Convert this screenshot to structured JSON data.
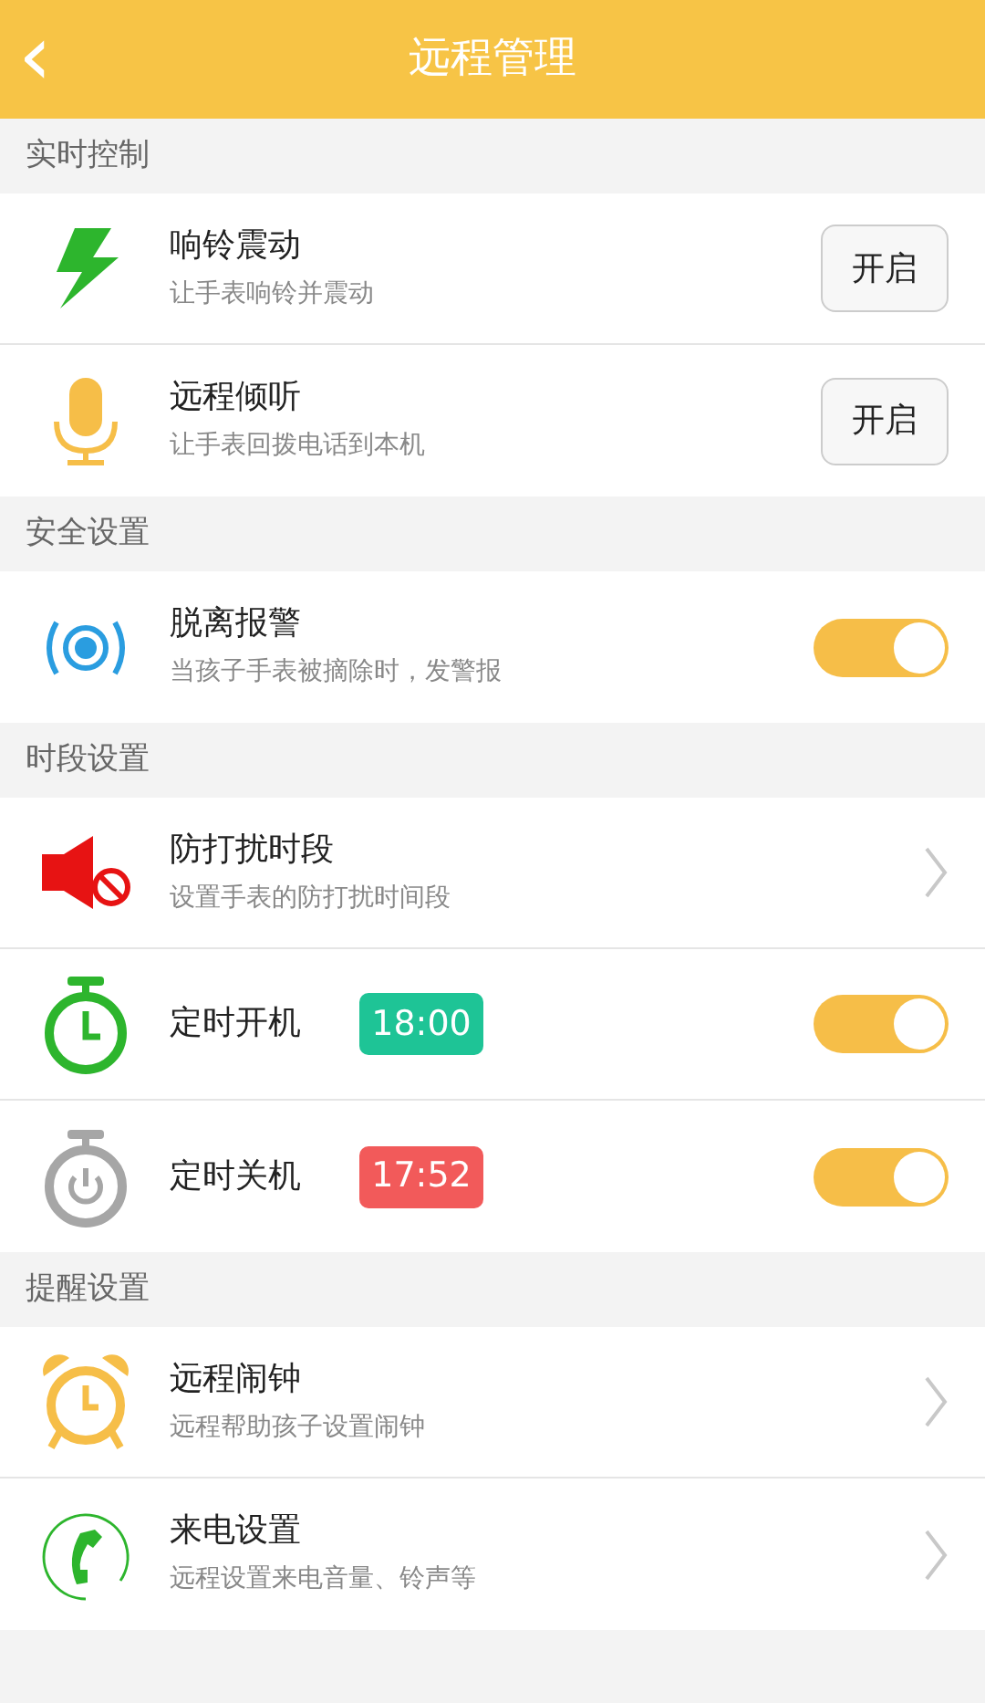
{
  "header": {
    "back": "‹",
    "title": "远程管理"
  },
  "sections": [
    {
      "title": "实时控制",
      "items": [
        {
          "kind": "button",
          "title": "响铃震动",
          "subtitle": "让手表响铃并震动",
          "button": "开启"
        },
        {
          "kind": "button",
          "title": "远程倾听",
          "subtitle": "让手表回拨电话到本机",
          "button": "开启"
        }
      ]
    },
    {
      "title": "安全设置",
      "items": [
        {
          "kind": "toggle",
          "title": "脱离报警",
          "subtitle": "当孩子手表被摘除时，发警报",
          "on": true
        }
      ]
    },
    {
      "title": "时段设置",
      "items": [
        {
          "kind": "chevron",
          "title": "防打扰时段",
          "subtitle": "设置手表的防打扰时间段"
        },
        {
          "kind": "toggle",
          "title": "定时开机",
          "time": {
            "text": "18:00",
            "color": "#1ec496"
          },
          "on": true
        },
        {
          "kind": "toggle",
          "title": "定时关机",
          "time": {
            "text": "17:52",
            "color": "#f25a5a"
          },
          "on": true
        }
      ]
    },
    {
      "title": "提醒设置",
      "items": [
        {
          "kind": "chevron",
          "title": "远程闹钟",
          "subtitle": "远程帮助孩子设置闹钟"
        },
        {
          "kind": "chevron",
          "title": "来电设置",
          "subtitle": "远程设置来电音量、铃声等"
        }
      ]
    }
  ]
}
